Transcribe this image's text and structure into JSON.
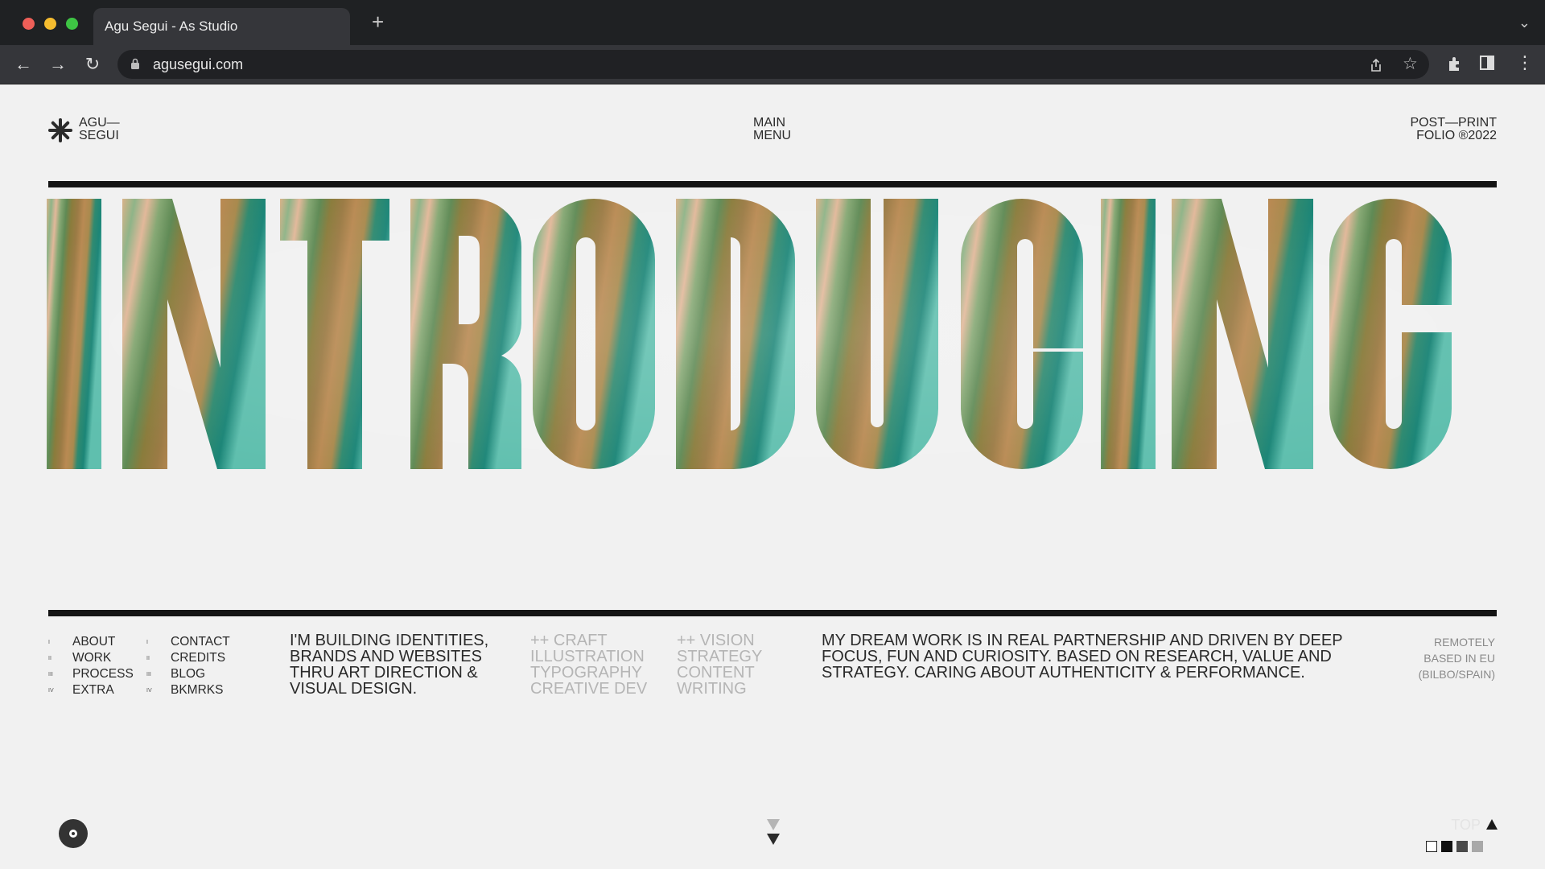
{
  "browser": {
    "tab_title": "Agu Segui - As Studio",
    "new_tab_icon": "plus-icon",
    "url": "agusegui.com",
    "traffic_colors": [
      "#ee5f58",
      "#f5bc2f",
      "#3ec444"
    ]
  },
  "header": {
    "logo_line1": "AGU—",
    "logo_line2": "SEGUI",
    "menu_line1": "MAIN",
    "menu_line2": "MENU",
    "right_line1": "POST—PRINT",
    "right_line2": "FOLIO ®2022"
  },
  "hero": {
    "word": "INTRODUCING"
  },
  "nav": {
    "col1": [
      {
        "num": "I",
        "label": "ABOUT"
      },
      {
        "num": "II",
        "label": "WORK"
      },
      {
        "num": "III",
        "label": "PROCESS"
      },
      {
        "num": "IV",
        "label": "EXTRA"
      }
    ],
    "col2": [
      {
        "num": "I",
        "label": "CONTACT"
      },
      {
        "num": "II",
        "label": "CREDITS"
      },
      {
        "num": "III",
        "label": "BLOG"
      },
      {
        "num": "IV",
        "label": "BKMRKS"
      }
    ]
  },
  "intro": {
    "lines": [
      "I'M BUILDING IDENTITIES,",
      "BRANDS AND WEBSITES",
      "THRU ART DIRECTION &",
      "VISUAL DESIGN."
    ]
  },
  "craft": {
    "lines": [
      "++ CRAFT",
      "ILLUSTRATION",
      "TYPOGRAPHY",
      "CREATIVE DEV"
    ]
  },
  "vision": {
    "lines": [
      "++ VISION",
      "STRATEGY",
      "CONTENT",
      "WRITING"
    ]
  },
  "dream": {
    "lines": [
      "MY DREAM WORK IS IN REAL PARTNERSHIP AND DRIVEN BY DEEP",
      "FOCUS, FUN AND CURIOSITY. BASED ON RESEARCH, VALUE AND",
      "STRATEGY. CARING ABOUT AUTHENTICITY & PERFORMANCE."
    ]
  },
  "location": {
    "lines": [
      "REMOTELY",
      "BASED IN EU",
      "(BILBO/SPAIN)"
    ]
  },
  "footer": {
    "top_label": "TOP",
    "swatches": [
      "#ffffff",
      "#111111",
      "#4a4a4a",
      "#a8a8a8"
    ]
  }
}
